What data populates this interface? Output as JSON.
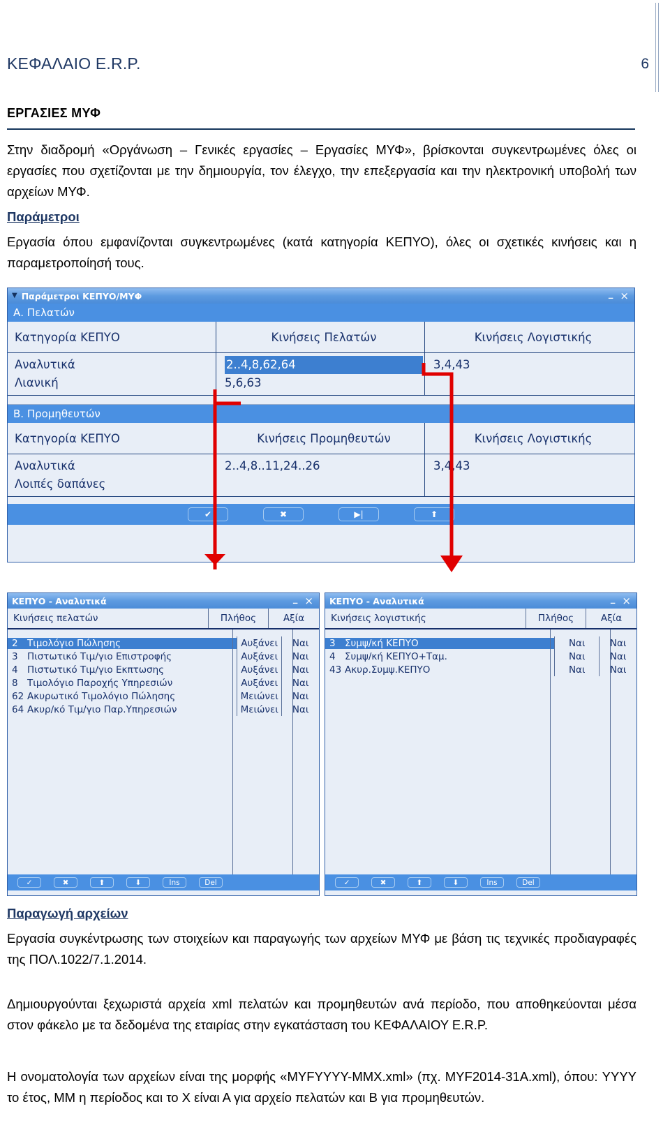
{
  "header": {
    "title": "ΚΕΦΑΛΑΙΟ E.R.P.",
    "page_number": "6"
  },
  "section": {
    "heading": "ΕΡΓΑΣΙΕΣ ΜΥΦ",
    "intro": "Στην διαδρομή «Οργάνωση – Γενικές εργασίες – Εργασίες ΜΥΦ», βρίσκονται συγκεντρωμένες όλες οι εργασίες που σχετίζονται με την δημιουργία, τον έλεγχο, την επεξεργασία και την ηλεκτρονική υποβολή των αρχείων ΜΥΦ.",
    "parameters_heading": "Παράμετροι",
    "parameters_text": "Εργασία όπου εμφανίζονται συγκεντρωμένες (κατά κατηγορία ΚΕΠΥΟ), όλες οι σχετικές κινήσεις και η παραμετροποίησή τους.",
    "production_heading": "Παραγωγή αρχείων",
    "production_text": "Εργασία συγκέντρωσης των στοιχείων και παραγωγής των αρχείων ΜΥΦ με βάση τις τεχνικές προδιαγραφές της ΠΟΛ.1022/7.1.2014.",
    "production_text2": "Δημιουργούνται ξεχωριστά αρχεία xml πελατών και προμηθευτών ανά περίοδο, που αποθηκεύονται μέσα στον φάκελο με τα δεδομένα της εταιρίας στην εγκατάσταση του ΚΕΦΑΛΑΙΟΥ E.R.P.",
    "production_text3": "Η ονοματολογία των αρχείων είναι της μορφής «ΜΥFYYYY-MMX.xml» (πχ. MYF2014-31A.xml), όπου: YYYY το έτος, ΜΜ η περίοδος και το Χ είναι Α για αρχείο πελατών και Β για προμηθευτών."
  },
  "params_window": {
    "title": "Παράμετροι ΚΕΠΥΟ/ΜΥΦ",
    "caret_icon": "triangle-down-icon",
    "minimize_label": "_",
    "close_label": "×",
    "sections": [
      {
        "band": "Α. Πελατών",
        "columns": [
          "Κατηγορία ΚΕΠΥΟ",
          "Κινήσεις Πελατών",
          "Κινήσεις Λογιστικής"
        ],
        "rows": [
          {
            "category": "Αναλυτικά",
            "moves": "2..4,8,62,64",
            "accounting": "3,4,43",
            "selected": true
          },
          {
            "category": "Λιανική",
            "moves": "5,6,63",
            "accounting": "",
            "selected": false
          }
        ]
      },
      {
        "band": "Β. Προμηθευτών",
        "columns": [
          "Κατηγορία ΚΕΠΥΟ",
          "Κινήσεις Προμηθευτών",
          "Κινήσεις Λογιστικής"
        ],
        "rows": [
          {
            "category": "Αναλυτικά",
            "moves": "2..4,8..11,24..26",
            "accounting": "3,4,43",
            "selected": false
          },
          {
            "category": "Λοιπές δαπάνες",
            "moves": "",
            "accounting": "",
            "selected": false
          }
        ]
      }
    ],
    "toolbar": [
      {
        "icon": "checkmark-icon",
        "glyph": "✔"
      },
      {
        "icon": "cancel-x-icon",
        "glyph": "✖"
      },
      {
        "icon": "play-to-end-icon",
        "glyph": "▶|"
      },
      {
        "icon": "arrow-up-icon",
        "glyph": "⬆"
      }
    ]
  },
  "kepyo_left": {
    "title": "ΚΕΠΥΟ - Αναλυτικά",
    "minimize_label": "_",
    "close_label": "×",
    "columns": [
      "Κινήσεις πελατών",
      "Πλήθος",
      "Αξία"
    ],
    "rows": [
      {
        "code": "2",
        "label": "Τιμολόγιο Πώλησης",
        "count": "Αυξάνει",
        "value": "Ναι",
        "selected": true
      },
      {
        "code": "3",
        "label": "Πιστωτικό Τιμ/γιο Επιστροφής",
        "count": "Αυξάνει",
        "value": "Ναι",
        "selected": false
      },
      {
        "code": "4",
        "label": "Πιστωτικό Τιμ/γιο Εκπτωσης",
        "count": "Αυξάνει",
        "value": "Ναι",
        "selected": false
      },
      {
        "code": "8",
        "label": "Τιμολόγιο Παροχής Υπηρεσιών",
        "count": "Αυξάνει",
        "value": "Ναι",
        "selected": false
      },
      {
        "code": "62",
        "label": "Ακυρωτικό Τιμολόγιο Πώλησης",
        "count": "Μειώνει",
        "value": "Ναι",
        "selected": false
      },
      {
        "code": "64",
        "label": "Ακυρ/κό Τιμ/γιο Παρ.Υπηρεσιών",
        "count": "Μειώνει",
        "value": "Ναι",
        "selected": false
      }
    ],
    "toolbar": [
      {
        "icon": "checkmark-icon",
        "glyph": "✓"
      },
      {
        "icon": "cancel-x-icon",
        "glyph": "✖"
      },
      {
        "icon": "arrow-up-icon",
        "glyph": "⬆"
      },
      {
        "icon": "arrow-down-icon",
        "glyph": "⬇"
      },
      {
        "icon": "insert-icon",
        "glyph": "Ins"
      },
      {
        "icon": "delete-icon",
        "glyph": "Del"
      }
    ]
  },
  "kepyo_right": {
    "title": "ΚΕΠΥΟ - Αναλυτικά",
    "minimize_label": "_",
    "close_label": "×",
    "columns": [
      "Κινήσεις λογιστικής",
      "Πλήθος",
      "Αξία"
    ],
    "rows": [
      {
        "code": "3",
        "label": "Συμψ/κή ΚΕΠΥΟ",
        "count": "Ναι",
        "value": "Ναι",
        "selected": true
      },
      {
        "code": "4",
        "label": "Συμψ/κή ΚΕΠΥΟ+Ταμ.",
        "count": "Ναι",
        "value": "Ναι",
        "selected": false
      },
      {
        "code": "43",
        "label": "Ακυρ.Συμψ.ΚΕΠΥΟ",
        "count": "Ναι",
        "value": "Ναι",
        "selected": false
      }
    ],
    "toolbar": [
      {
        "icon": "checkmark-icon",
        "glyph": "✓"
      },
      {
        "icon": "cancel-x-icon",
        "glyph": "✖"
      },
      {
        "icon": "arrow-up-icon",
        "glyph": "⬆"
      },
      {
        "icon": "arrow-down-icon",
        "glyph": "⬇"
      },
      {
        "icon": "insert-icon",
        "glyph": "Ins"
      },
      {
        "icon": "delete-icon",
        "glyph": "Del"
      }
    ]
  },
  "colors": {
    "heading_blue": "#1f3864",
    "title_bar_blue": "#4b8cd8",
    "band_blue": "#4a90e2",
    "selection_blue": "#3d7fd0",
    "window_bg": "#e8eef7",
    "annotation_red": "#e00000"
  }
}
